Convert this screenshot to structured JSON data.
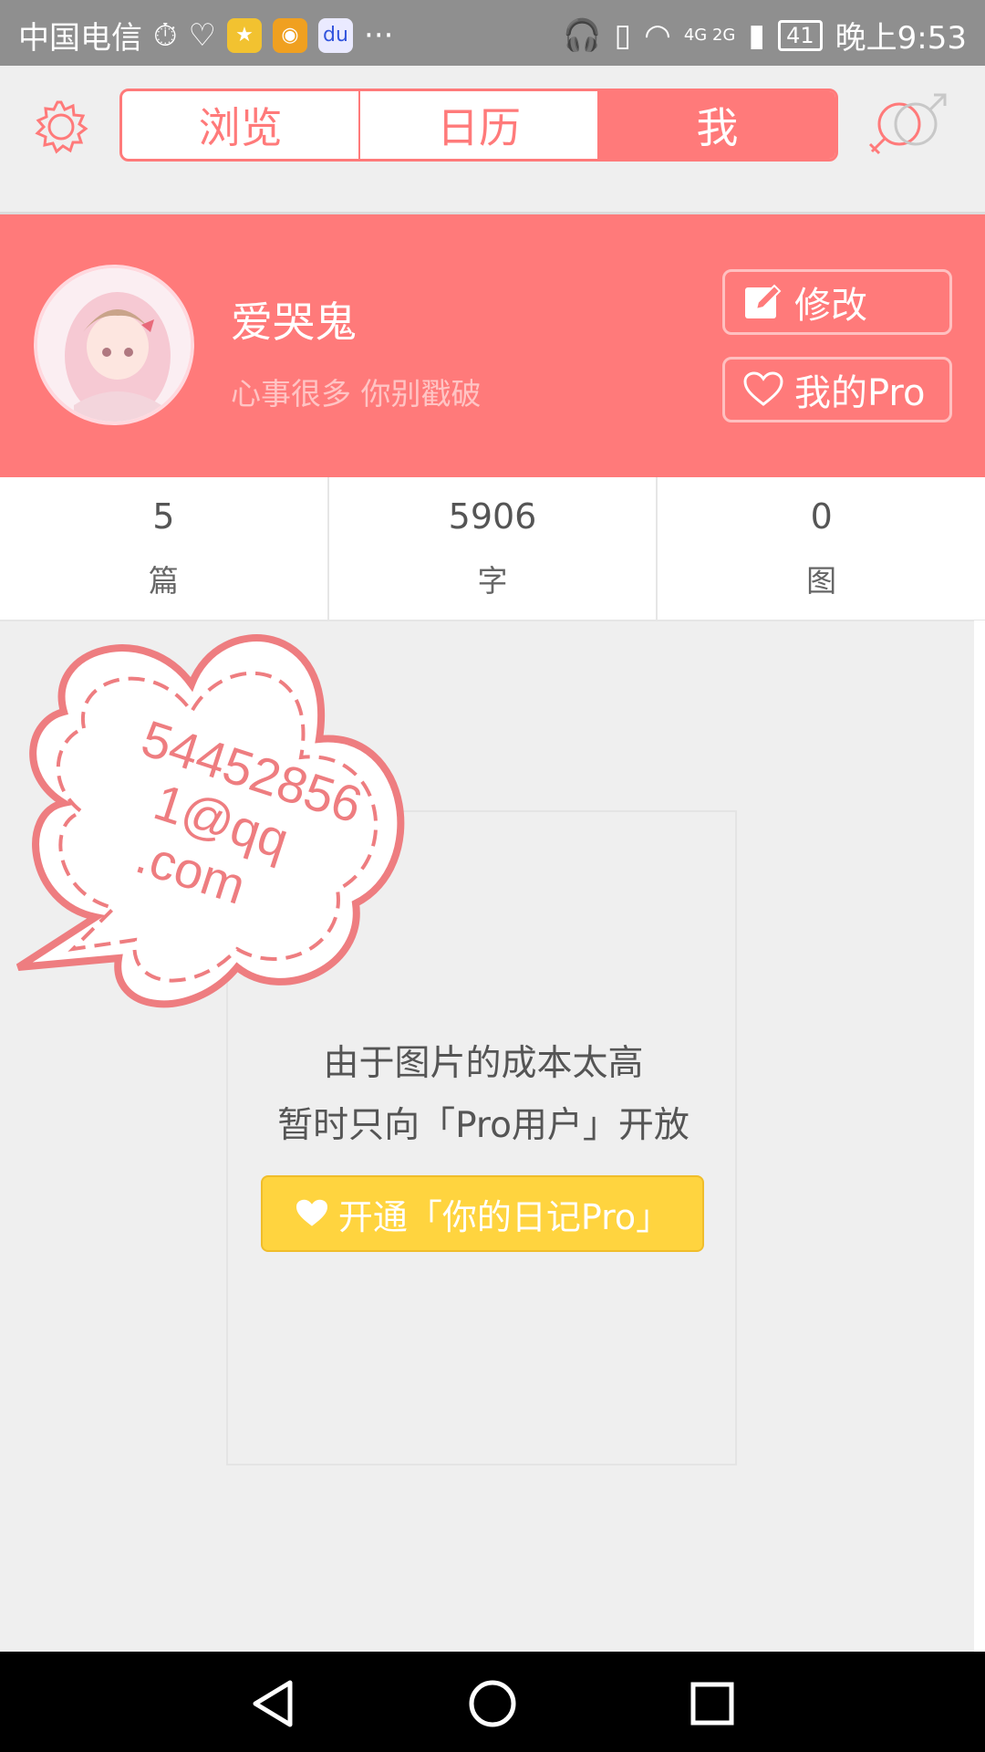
{
  "status_bar": {
    "carrier": "中国电信",
    "more": "···",
    "network": "4G 2G",
    "battery": "41",
    "time": "晚上9:53"
  },
  "tabs": [
    {
      "label": "浏览"
    },
    {
      "label": "日历"
    },
    {
      "label": "我"
    }
  ],
  "profile": {
    "username": "爱哭鬼",
    "bio": "心事很多  你别戳破",
    "edit_label": "修改",
    "pro_label": "我的Pro"
  },
  "stats": [
    {
      "value": "5",
      "label": "篇"
    },
    {
      "value": "5906",
      "label": "字"
    },
    {
      "value": "0",
      "label": "图"
    }
  ],
  "notice": {
    "line1": "由于图片的成本太高",
    "line2": "暂时只向「Pro用户」开放",
    "button_label": "开通「你的日记Pro」"
  },
  "cloud_bubble": {
    "line1": "54452856",
    "line2": "1@qq",
    "line3": ".com"
  },
  "colors": {
    "accent": "#ff7a7a",
    "pro_yellow": "#ffd43f"
  }
}
